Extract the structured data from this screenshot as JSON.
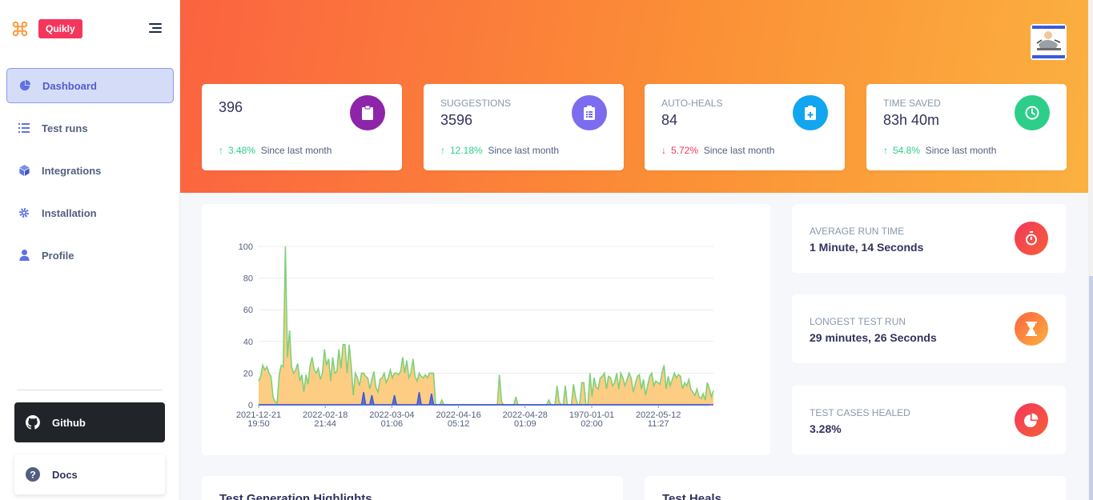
{
  "brand": {
    "name": "Quikly"
  },
  "sidebar": {
    "items": [
      {
        "label": "Dashboard",
        "icon": "pie-chart-icon",
        "active": true
      },
      {
        "label": "Test runs",
        "icon": "list-icon"
      },
      {
        "label": "Integrations",
        "icon": "cube-icon"
      },
      {
        "label": "Installation",
        "icon": "gear-icon"
      },
      {
        "label": "Profile",
        "icon": "user-icon"
      }
    ],
    "github_label": "Github",
    "docs_label": "Docs"
  },
  "stats": [
    {
      "label": "",
      "value": "396",
      "change": "3.48%",
      "direction": "up",
      "since": "Since last month",
      "icon": "clipboard-icon",
      "color": "#8e24aa"
    },
    {
      "label": "Suggestions",
      "value": "3596",
      "change": "12.18%",
      "direction": "up",
      "since": "Since last month",
      "icon": "checklist-icon",
      "color": "#7c6cf0"
    },
    {
      "label": "Auto-Heals",
      "value": "84",
      "change": "5.72%",
      "direction": "down",
      "since": "Since last month",
      "icon": "medical-clipboard-icon",
      "color": "#11a6ef"
    },
    {
      "label": "Time Saved",
      "value": "83h 40m",
      "change": "54.8%",
      "direction": "up",
      "since": "Since last month",
      "icon": "clock-icon",
      "color": "#2dce89"
    }
  ],
  "info_cards": [
    {
      "label": "Average Run Time",
      "value": "1 Minute, 14 Seconds",
      "icon": "stopwatch-icon",
      "color": "#f5365c"
    },
    {
      "label": "Longest Test Run",
      "value": "29 minutes, 26 Seconds",
      "icon": "hourglass-icon",
      "color": "#fb6340"
    },
    {
      "label": "Test Cases Healed",
      "value": "3.28%",
      "icon": "pie-chart-icon",
      "color": "#f5365c"
    }
  ],
  "bottom": {
    "left_title": "Test Generation Highlights",
    "right_title": "Test Heals"
  },
  "chart_data": {
    "type": "area",
    "ylim": [
      0,
      100
    ],
    "yticks": [
      "0",
      "20",
      "40",
      "60",
      "80",
      "100"
    ],
    "xticks": [
      {
        "date": "2021-12-21",
        "time": "19:50"
      },
      {
        "date": "2022-02-18",
        "time": "21:44"
      },
      {
        "date": "2022-03-04",
        "time": "01:06"
      },
      {
        "date": "2022-04-16",
        "time": "05:12"
      },
      {
        "date": "2022-04-28",
        "time": "01:09"
      },
      {
        "date": "1970-01-01",
        "time": "02:00"
      },
      {
        "date": "2022-05-12",
        "time": "11:27"
      }
    ],
    "grid": true,
    "series": [
      {
        "color": "#7fd17a",
        "fill": "#fdcd84",
        "values": [
          15,
          18,
          25,
          22,
          24,
          20,
          18,
          5,
          2,
          1,
          19,
          25,
          24,
          100,
          30,
          47,
          24,
          20,
          22,
          26,
          15,
          19,
          8,
          19,
          13,
          25,
          30,
          22,
          20,
          23,
          16,
          20,
          35,
          25,
          29,
          15,
          30,
          20,
          21,
          35,
          23,
          38,
          38,
          20,
          38,
          24,
          6,
          20,
          17,
          12,
          20,
          20,
          18,
          17,
          10,
          16,
          21,
          11,
          8,
          16,
          17,
          20,
          14,
          17,
          22,
          17,
          20,
          20,
          19,
          21,
          30,
          20,
          28,
          17,
          20,
          29,
          18,
          15,
          20,
          18,
          17,
          19,
          17,
          20,
          20,
          20,
          0,
          0,
          0,
          3,
          0,
          0,
          0,
          0,
          0,
          0,
          0,
          0,
          0,
          0,
          0,
          0,
          0,
          0,
          0,
          0,
          0,
          0,
          0,
          0,
          0,
          0,
          0,
          0,
          0,
          0,
          0,
          19,
          2,
          0,
          0,
          0,
          0,
          0,
          0,
          5,
          0,
          0,
          0,
          0,
          0,
          0,
          0,
          0,
          0,
          0,
          0,
          0,
          0,
          0,
          0,
          3,
          0,
          0,
          0,
          12,
          2,
          0,
          0,
          12,
          0,
          0,
          0,
          13,
          5,
          0,
          0,
          14,
          14,
          0,
          0,
          20,
          5,
          17,
          11,
          10,
          17,
          18,
          20,
          10,
          18,
          17,
          12,
          14,
          20,
          10,
          20,
          17,
          12,
          16,
          20,
          17,
          8,
          13,
          18,
          19,
          10,
          16,
          6,
          12,
          18,
          20,
          12,
          15,
          14,
          13,
          20,
          25,
          10,
          18,
          12,
          16,
          20,
          17,
          19,
          18,
          10,
          14,
          12,
          16,
          10,
          8,
          6,
          10,
          5,
          4,
          7,
          3,
          14,
          10,
          5,
          9
        ]
      },
      {
        "color": "#3d5bd9",
        "values": [
          0,
          0,
          0,
          0,
          0,
          0,
          0,
          0,
          0,
          0,
          0,
          0,
          0,
          0,
          0,
          0,
          0,
          0,
          0,
          0,
          0,
          0,
          0,
          0,
          0,
          0,
          0,
          0,
          0,
          0,
          0,
          0,
          0,
          0,
          0,
          0,
          0,
          0,
          0,
          0,
          0,
          0,
          0,
          0,
          0,
          0,
          0,
          0,
          0,
          0,
          0,
          8,
          0,
          0,
          0,
          6,
          0,
          0,
          0,
          0,
          0,
          0,
          0,
          0,
          0,
          0,
          6,
          0,
          0,
          0,
          0,
          0,
          0,
          0,
          0,
          0,
          0,
          0,
          8,
          0,
          0,
          0,
          0,
          0,
          7,
          0,
          0,
          0,
          0,
          0,
          0,
          0,
          0,
          0,
          0,
          0,
          0,
          0,
          0,
          0,
          0,
          0,
          0,
          0,
          0,
          0,
          0,
          0,
          0,
          0,
          0,
          0,
          0,
          0,
          0,
          0,
          0,
          0,
          0,
          0,
          0,
          0,
          0,
          0,
          0,
          0,
          0,
          0,
          0,
          0,
          0,
          0,
          0,
          0,
          0,
          0,
          0,
          0,
          0,
          0,
          0,
          0,
          0,
          0,
          0,
          0,
          0,
          0,
          0,
          0,
          0,
          0,
          0,
          0,
          0,
          0,
          0,
          0,
          0,
          0,
          0,
          0,
          0,
          0,
          0,
          0,
          0,
          0,
          0,
          0,
          0,
          0,
          0,
          0,
          0,
          0,
          0,
          0,
          0,
          0,
          0,
          0,
          0,
          0,
          0,
          0,
          0,
          0,
          0,
          0,
          0,
          0,
          0,
          0,
          0,
          0,
          0,
          0,
          0,
          0,
          0,
          0,
          0,
          0,
          0,
          0,
          0,
          0,
          0,
          0,
          0,
          0,
          0,
          0,
          0,
          0,
          0,
          0,
          0,
          0
        ]
      }
    ]
  }
}
